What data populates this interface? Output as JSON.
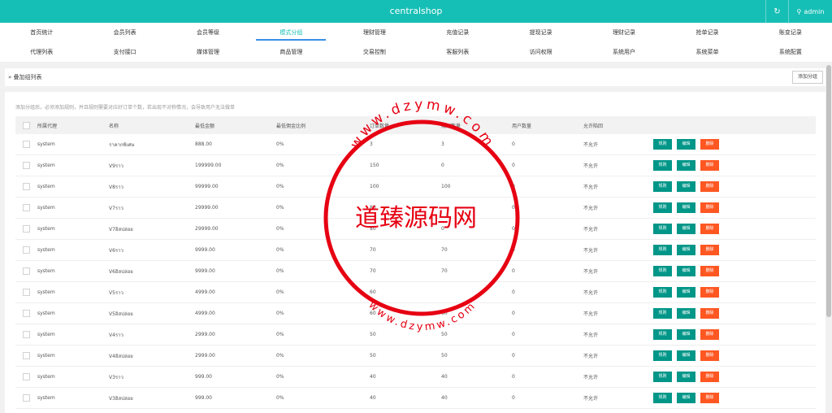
{
  "topbar": {
    "title": "centralshop",
    "refresh_icon": "↻",
    "user_label": "admin",
    "user_icon": "⚲"
  },
  "nav": {
    "row1": [
      "首页统计",
      "会员列表",
      "会员等级",
      "模式分组",
      "理财管理",
      "充值记录",
      "提现记录",
      "理财记录",
      "抢单记录",
      "账变记录"
    ],
    "row2": [
      "代理列表",
      "支付接口",
      "媒体管理",
      "商品管理",
      "交易控制",
      "客服列表",
      "访问权限",
      "系统用户",
      "系统菜单",
      "系统配置"
    ],
    "active": "模式分组"
  },
  "crumb": {
    "icon": "»",
    "label": "叠加组列表",
    "add_button": "添加分组"
  },
  "notice": "添加分组后，必须添加规则，并且规则需要对应好订单个数，若出现不对称情况，会导致用户无法做单",
  "table": {
    "headers": [
      "所属代理",
      "名称",
      "最低金额",
      "最低佣金比例",
      "订单数量",
      "规则数量",
      "用户数量",
      "允许陷回"
    ],
    "rows": [
      [
        "system",
        "ราคากพิเศษ",
        "888.00",
        "0%",
        "3",
        "3",
        "0",
        "不允许"
      ],
      [
        "system",
        "V9ราว",
        "199999.00",
        "0%",
        "150",
        "0",
        "0",
        "不允许"
      ],
      [
        "system",
        "V8ราว",
        "99999.00",
        "0%",
        "100",
        "100",
        "0",
        "不允许"
      ],
      [
        "system",
        "V7ราว",
        "29999.00",
        "0%",
        "80",
        "",
        "0",
        "不允许"
      ],
      [
        "system",
        "V7อิสปล่อย",
        "29999.00",
        "0%",
        "80",
        "0",
        "0",
        "不允许"
      ],
      [
        "system",
        "V6ราว",
        "9999.00",
        "0%",
        "70",
        "70",
        "0",
        "不允许"
      ],
      [
        "system",
        "V6อิสปล่อย",
        "9999.00",
        "0%",
        "70",
        "70",
        "0",
        "不允许"
      ],
      [
        "system",
        "V5ราว",
        "4999.00",
        "0%",
        "60",
        "",
        "0",
        "不允许"
      ],
      [
        "system",
        "V5อิสปล่อย",
        "4999.00",
        "0%",
        "60",
        "60",
        "0",
        "不允许"
      ],
      [
        "system",
        "V4ราว",
        "2999.00",
        "0%",
        "50",
        "50",
        "0",
        "不允许"
      ],
      [
        "system",
        "V4อิสปล่อย",
        "2999.00",
        "0%",
        "50",
        "50",
        "0",
        "不允许"
      ],
      [
        "system",
        "V3ราว",
        "999.00",
        "0%",
        "40",
        "40",
        "0",
        "不允许"
      ],
      [
        "system",
        "V3อิสปล่อย",
        "999.00",
        "0%",
        "40",
        "40",
        "0",
        "不允许"
      ]
    ],
    "actions": {
      "rules": "规则",
      "edit": "编辑",
      "delete": "删除"
    }
  },
  "watermark": {
    "text": "道臻源码网",
    "top_arc": "www.dzymw.com",
    "bottom_arc": "www.dzymw.com",
    "color": "#e60012"
  },
  "colors": {
    "header": "#16bfb5",
    "teal_button": "#009688",
    "orange_button": "#ff5722",
    "active_tab_underline": "#3a8ee6"
  }
}
